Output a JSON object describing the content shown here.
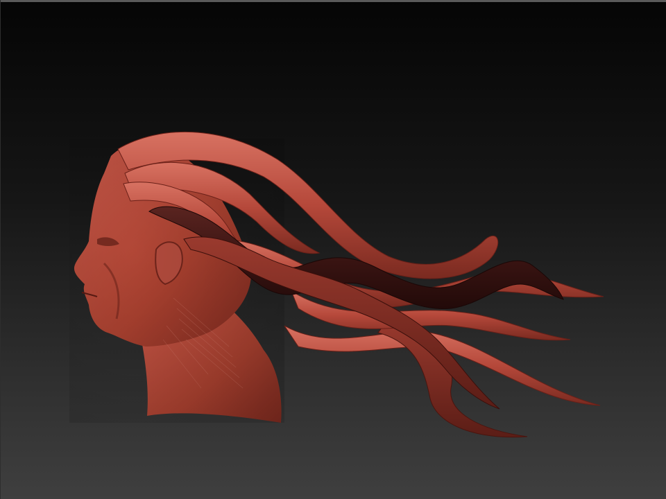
{
  "viewport": {
    "background_top": "#050505",
    "background_bottom": "#3f3f3f"
  },
  "model": {
    "subject": "sculpted-head-with-flowing-tentacle-hair",
    "clay_color": "#b5483a",
    "clay_highlight": "#d86c5c",
    "clay_shadow": "#6e1f18",
    "dark_strand_color": "#3a1412"
  }
}
